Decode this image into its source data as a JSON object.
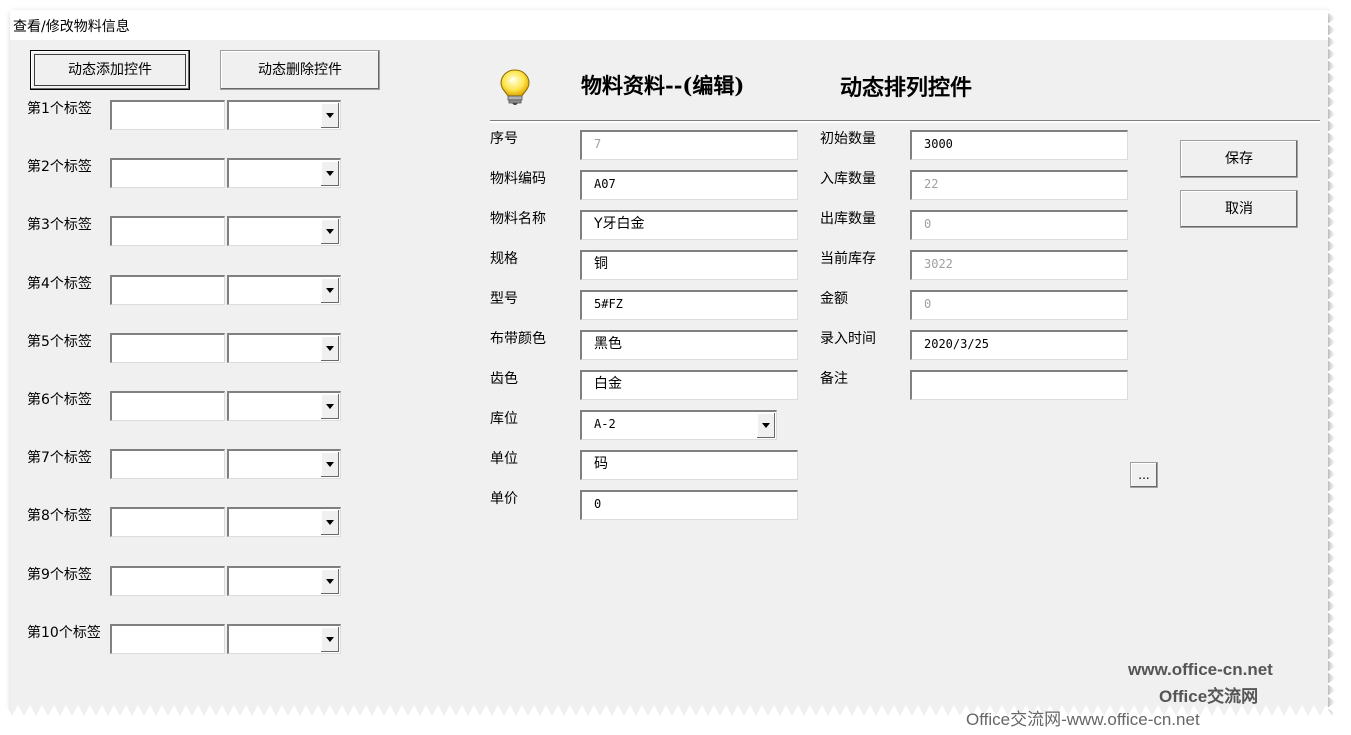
{
  "window": {
    "title": "查看/修改物料信息"
  },
  "left": {
    "add_button": "动态添加控件",
    "delete_button": "动态删除控件",
    "labels": [
      "第1个标签",
      "第2个标签",
      "第3个标签",
      "第4个标签",
      "第5个标签",
      "第6个标签",
      "第7个标签",
      "第8个标签",
      "第9个标签",
      "第10个标签"
    ]
  },
  "header": {
    "title": "物料资料--(编辑)",
    "subtitle": "动态排列控件",
    "icon": "lightbulb-icon"
  },
  "form": {
    "col1": [
      {
        "label": "序号",
        "value": "7",
        "disabled": true
      },
      {
        "label": "物料编码",
        "value": "A07",
        "disabled": false
      },
      {
        "label": "物料名称",
        "value": "Y牙白金",
        "disabled": false
      },
      {
        "label": "规格",
        "value": "铜",
        "disabled": false
      },
      {
        "label": "型号",
        "value": "5#FZ",
        "disabled": false
      },
      {
        "label": "布带颜色",
        "value": "黑色",
        "disabled": false
      },
      {
        "label": "齿色",
        "value": "白金",
        "disabled": false
      },
      {
        "label": "库位",
        "value": "A-2",
        "disabled": false
      },
      {
        "label": "单位",
        "value": "码",
        "disabled": false
      },
      {
        "label": "单价",
        "value": "0",
        "disabled": false
      }
    ],
    "col2": [
      {
        "label": "初始数量",
        "value": "3000",
        "disabled": false
      },
      {
        "label": "入库数量",
        "value": "22",
        "disabled": true
      },
      {
        "label": "出库数量",
        "value": "0",
        "disabled": true
      },
      {
        "label": "当前库存",
        "value": "3022",
        "disabled": true
      },
      {
        "label": "金额",
        "value": "0",
        "disabled": true
      },
      {
        "label": "录入时间",
        "value": "2020/3/25",
        "disabled": false
      },
      {
        "label": "备注",
        "value": "",
        "disabled": false
      }
    ]
  },
  "actions": {
    "save": "保存",
    "cancel": "取消",
    "browse": "..."
  },
  "watermark": {
    "line1": "www.office-cn.net",
    "line2": "Office交流网",
    "footer": "Office交流网-www.office-cn.net"
  }
}
